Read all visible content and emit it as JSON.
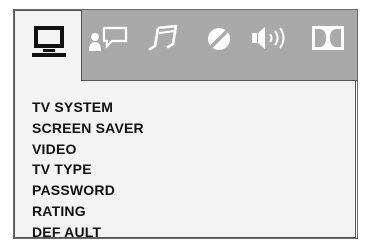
{
  "tabs": [
    {
      "icon": "monitor-icon",
      "active": true
    },
    {
      "icon": "person-speech-icon",
      "active": false
    },
    {
      "icon": "music-note-icon",
      "active": false
    },
    {
      "icon": "circle-slash-icon",
      "active": false
    },
    {
      "icon": "speaker-sound-icon",
      "active": false
    },
    {
      "icon": "dolby-icon",
      "active": false
    }
  ],
  "menu": {
    "items": [
      {
        "label": "TV SYSTEM"
      },
      {
        "label": "SCREEN SAVER"
      },
      {
        "label": "VIDEO"
      },
      {
        "label": "TV TYPE"
      },
      {
        "label": "PASSWORD"
      },
      {
        "label": "RATING"
      },
      {
        "label": "DEF AULT"
      }
    ]
  },
  "colors": {
    "tabbar": "#a9a9a9",
    "panel": "#f3f3f3",
    "icon_active": "#111111",
    "icon_inactive": "#ffffff"
  }
}
